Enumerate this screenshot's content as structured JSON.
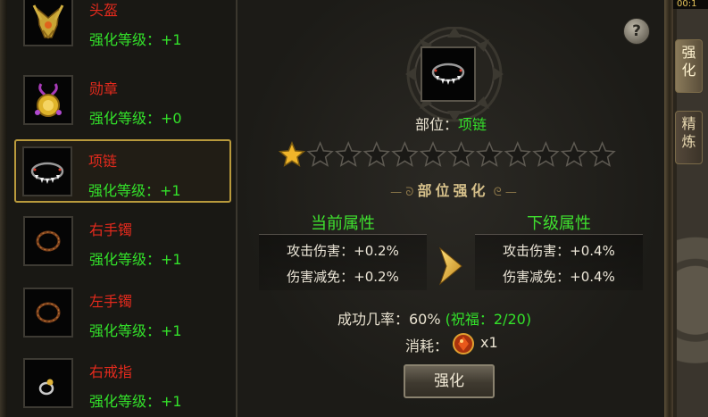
{
  "items": [
    {
      "name": "头盔",
      "level_label": "强化等级：+1",
      "icon": "helmet-icon",
      "selected": false
    },
    {
      "name": "勋章",
      "level_label": "强化等级：+0",
      "icon": "medal-icon",
      "selected": false
    },
    {
      "name": "项链",
      "level_label": "强化等级：+1",
      "icon": "necklace-icon",
      "selected": true
    },
    {
      "name": "右手镯",
      "level_label": "强化等级：+1",
      "icon": "bracelet-icon",
      "selected": false
    },
    {
      "name": "左手镯",
      "level_label": "强化等级：+1",
      "icon": "bracelet-icon",
      "selected": false
    },
    {
      "name": "右戒指",
      "level_label": "强化等级：+1",
      "icon": "ring-icon",
      "selected": false
    }
  ],
  "help_label": "?",
  "part": {
    "label": "部位：",
    "value": "项链"
  },
  "stars": {
    "filled": 1,
    "total": 12
  },
  "section_title": "部位强化",
  "current": {
    "title": "当前属性",
    "rows": [
      "攻击伤害：+0.2%",
      "伤害减免：+0.2%"
    ]
  },
  "next": {
    "title": "下级属性",
    "rows": [
      "攻击伤害：+0.4%",
      "伤害减免：+0.4%"
    ]
  },
  "success_rate": {
    "label": "成功几率：60%",
    "blessing": "(祝福：2/20)"
  },
  "cost": {
    "label": "消耗：",
    "quantity": "x1",
    "icon": "red-gem-icon"
  },
  "enhance_button": "强化",
  "side_tabs": [
    {
      "label": "强化",
      "active": true
    },
    {
      "label": "精炼",
      "active": false
    }
  ],
  "top_clock_fragment": "00:1",
  "colors": {
    "item_name": "#e32a1d",
    "level_text": "#33e12a",
    "selected_border": "#b99a3c",
    "star_filled": "#f0b52a",
    "star_empty": "#1a1916"
  }
}
